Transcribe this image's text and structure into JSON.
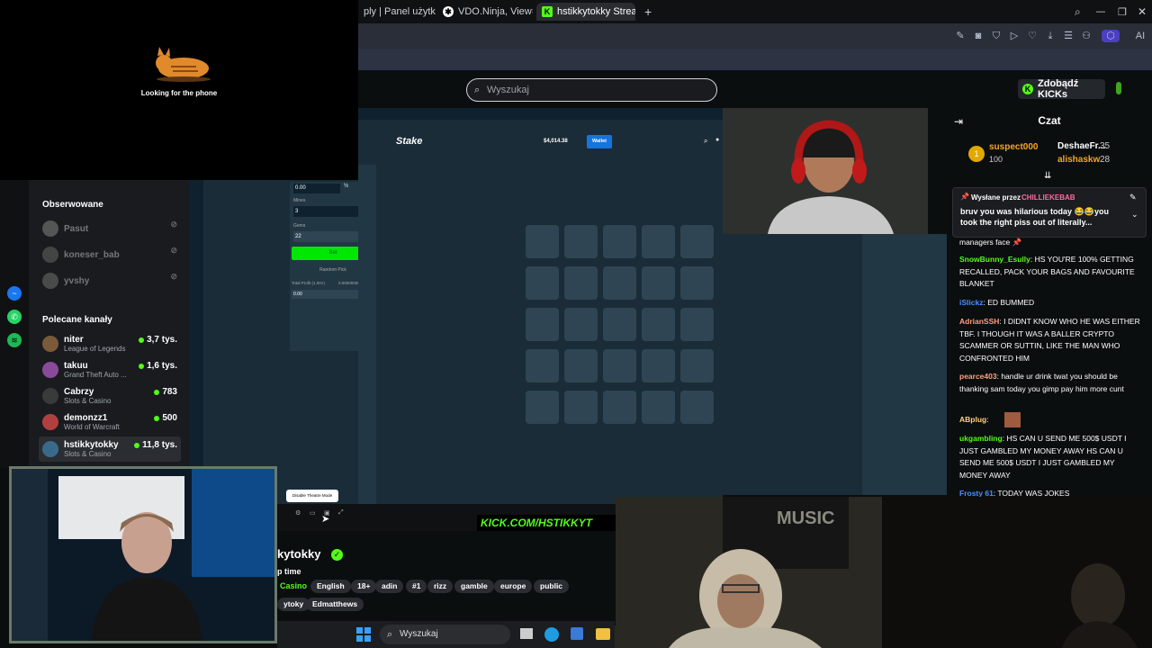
{
  "tabs": [
    {
      "label": "ply | Panel użytkownika"
    },
    {
      "label": "VDO.Ninja, View=pHTdw"
    },
    {
      "label": "hstikkytokky Stream - Wa"
    }
  ],
  "overlay": {
    "cat_label": "Looking for the phone"
  },
  "search": {
    "placeholder": "Wyszukaj"
  },
  "header": {
    "get_kicks": "Zdobądź KICKs"
  },
  "sidebar": {
    "followed_title": "Obserwowane",
    "followed": [
      {
        "name": "Pasut"
      },
      {
        "name": "koneser_bab"
      },
      {
        "name": "yvshy"
      }
    ],
    "recommended_title": "Polecane kanały",
    "recommended": [
      {
        "name": "niter",
        "game": "League of Legends",
        "views": "3,7 tys."
      },
      {
        "name": "takuu",
        "game": "Grand Theft Auto ...",
        "views": "1,6 tys."
      },
      {
        "name": "Cabrzy",
        "game": "Slots & Casino",
        "views": "783"
      },
      {
        "name": "demonzz1",
        "game": "World of Warcraft",
        "views": "500"
      },
      {
        "name": "hstikkytokky",
        "game": "Slots & Casino",
        "views": "11,8 tys."
      }
    ]
  },
  "stake": {
    "logo": "Stake",
    "balance": "$4,014.38",
    "wallet": "Wallet",
    "amount": "0.00",
    "mines_label": "Mines",
    "mines_value": "3",
    "gems_label": "Gems",
    "gems_value": "22",
    "bet_button": "Bet",
    "random_pick": "Random Pick",
    "total_profit_label": "Total Profit (1.00×)",
    "total_profit_usdt": "0.00000000 USDT",
    "total_profit_value": "0.00",
    "half": "½",
    "double": "2×"
  },
  "chat": {
    "title": "Czat",
    "leaderboard": [
      {
        "name": "suspect000",
        "points": "100"
      },
      {
        "name": "DeshaeFr...",
        "points": "35"
      },
      {
        "name": "alishaskw",
        "points": "28"
      }
    ],
    "pinned_label": "Wysłane przez",
    "pinned_by": "CHILLIEKEBAB",
    "pinned_text": "bruv you was hilarious today 😂😂you took the right piss out of literally...",
    "messages": [
      {
        "user": "",
        "text": "managers face 📌"
      },
      {
        "user": "SnowBunny_Esully",
        "color": "#53fc18",
        "text": "HS YOU'RE 100% GETTING RECALLED, PACK YOUR BAGS AND FAVOURITE BLANKET"
      },
      {
        "user": "iSlickz",
        "color": "#4a90ff",
        "text": "ED BUMMED"
      },
      {
        "user": "AdrianSSH",
        "color": "#ff9f80",
        "text": "I DIDNT KNOW WHO HE WAS EITHER TBF. I THOUGH IT WAS A BALLER CRYPTO SCAMMER OR SUTTIN, LIKE THE MAN WHO CONFRONTED HIM"
      },
      {
        "user": "pearce403",
        "color": "#ff9f80",
        "text": "handle ur drink twat you should be thanking sam today you gimp pay him more cunt"
      },
      {
        "user": "ABplug",
        "color": "#ffd27a",
        "text": ""
      },
      {
        "user": "ukgambling",
        "color": "#53fc18",
        "text": "HS CAN U SEND ME 500$ USDT I JUST GAMBLED MY MONEY AWAY HS CAN U SEND ME 500$ USDT I JUST GAMBLED MY MONEY AWAY"
      },
      {
        "user": "Frosty 61",
        "color": "#4a90ff",
        "text": "TODAY WAS JOKES"
      }
    ]
  },
  "stream": {
    "kick_banner": "KICK.COM/HSTIKKYT",
    "name": "kytokky",
    "title": "p time",
    "category": "Casino",
    "tags": [
      "English",
      "18+",
      "adin",
      "#1",
      "rizz",
      "gamble",
      "europe",
      "public"
    ],
    "extra_tags": [
      "ytoky",
      "Edmatthews"
    ],
    "tooltip": "Disable Theatre Mode"
  },
  "taskbar": {
    "search": "Wyszukaj"
  },
  "colors": {
    "kick_green": "#53fc18",
    "stake_blue": "#1475e1",
    "stake_bg": "#1a2c38"
  }
}
